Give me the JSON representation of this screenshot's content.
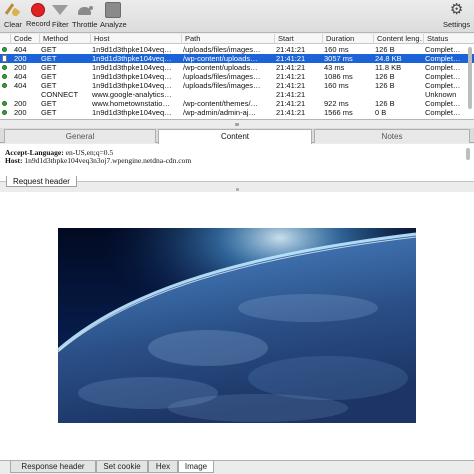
{
  "toolbar": {
    "clear": "Clear",
    "record": "Record",
    "filter": "Filter",
    "throttle": "Throttle",
    "analyze": "Analyze",
    "settings": "Settings",
    "icons": [
      "broom-icon",
      "record-icon",
      "funnel-icon",
      "turtle-icon",
      "analyze-icon",
      "gear-icon"
    ]
  },
  "table": {
    "columns": [
      "Code",
      "Method",
      "Host",
      "Path",
      "Start",
      "Duration",
      "Content leng…",
      "Status"
    ],
    "rows": [
      {
        "icon": "dot",
        "code": "404",
        "method": "GET",
        "host": "1n9d1d3thpke104veq…",
        "path": "/uploads/files/images…",
        "start": "21:41:21",
        "duration": "160 ms",
        "size": "126 B",
        "status": "Complet…",
        "selected": false
      },
      {
        "icon": "doc",
        "code": "200",
        "method": "GET",
        "host": "1n9d1d3thpke104veq…",
        "path": "/wp-content/uploads…",
        "start": "21:41:21",
        "duration": "3057 ms",
        "size": "24.8 KB",
        "status": "Complet…",
        "selected": true
      },
      {
        "icon": "dot",
        "code": "200",
        "method": "GET",
        "host": "1n9d1d3thpke104veq…",
        "path": "/wp-content/uploads…",
        "start": "21:41:21",
        "duration": "43 ms",
        "size": "11.8 KB",
        "status": "Complet…",
        "selected": false
      },
      {
        "icon": "dot",
        "code": "404",
        "method": "GET",
        "host": "1n9d1d3thpke104veq…",
        "path": "/uploads/files/images…",
        "start": "21:41:21",
        "duration": "1086 ms",
        "size": "126 B",
        "status": "Complet…",
        "selected": false
      },
      {
        "icon": "dot",
        "code": "404",
        "method": "GET",
        "host": "1n9d1d3thpke104veq…",
        "path": "/uploads/files/images…",
        "start": "21:41:21",
        "duration": "160 ms",
        "size": "126 B",
        "status": "Complet…",
        "selected": false
      },
      {
        "icon": "none",
        "code": "",
        "method": "CONNECT",
        "host": "www.google-analytics…",
        "path": "",
        "start": "21:41:21",
        "duration": "",
        "size": "",
        "status": "Unknown",
        "selected": false
      },
      {
        "icon": "dot",
        "code": "200",
        "method": "GET",
        "host": "www.hometownstatio…",
        "path": "/wp-content/themes/…",
        "start": "21:41:21",
        "duration": "922 ms",
        "size": "126 B",
        "status": "Complet…",
        "selected": false
      },
      {
        "icon": "dot",
        "code": "200",
        "method": "GET",
        "host": "1n9d1d3thpke104veq…",
        "path": "/wp-admin/admin-aj…",
        "start": "21:41:21",
        "duration": "1566 ms",
        "size": "0 B",
        "status": "Complet…",
        "selected": false
      }
    ]
  },
  "top_tabs": [
    "General",
    "Content",
    "Notes"
  ],
  "headers": {
    "accept_language_key": "Accept-Language:",
    "accept_language_val": "en-US,en;q=0.5",
    "host_key": "Host:",
    "host_val": "1n9d1d3thpke104veq3n3oj7.wpengine.netdna-cdn.com"
  },
  "request_tab": "Request header",
  "bottom_tabs": [
    "Response header",
    "Set cookie",
    "Hex",
    "Image"
  ],
  "colors": {
    "selection": "#1b63d6",
    "record": "#e02222"
  }
}
